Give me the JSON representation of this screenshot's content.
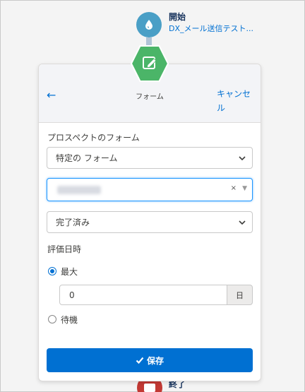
{
  "flow": {
    "start_title": "開始",
    "start_subtitle": "DX_メール送信テスト...",
    "end_label": "終了"
  },
  "panel": {
    "title": "フォーム",
    "back_icon": "back-arrow-icon",
    "cancel_label": "キャンセル"
  },
  "form": {
    "prospect_form_label": "プロスペクトのフォーム",
    "form_scope_select": "特定の フォーム",
    "form_clear_symbol": "×",
    "form_dropdown_symbol": "▼",
    "status_select": "完了済み",
    "evaluation_label": "評価日時",
    "max_option_label": "最大",
    "max_option_checked": true,
    "max_days_value": "0",
    "max_days_unit": "日",
    "wait_option_label": "待機",
    "wait_option_checked": false
  },
  "actions": {
    "save_label": "保存"
  },
  "colors": {
    "accent": "#0070d2",
    "start_node": "#4a9fc6",
    "form_node": "#4bb568",
    "end_node": "#c23934"
  }
}
